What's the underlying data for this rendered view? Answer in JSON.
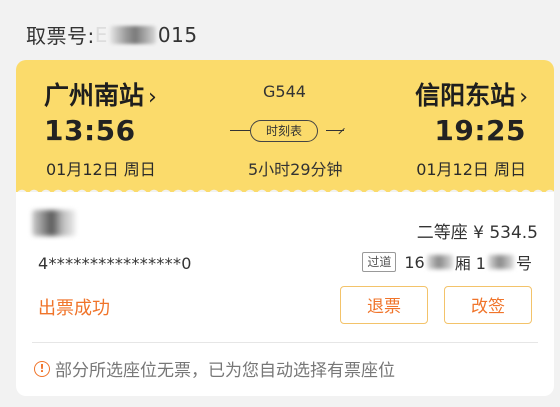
{
  "ticket": {
    "label": "取票号:",
    "number_prefix": "E",
    "number_suffix": "015"
  },
  "train": {
    "number": "G544",
    "schedule_label": "时刻表",
    "duration": "5小时29分钟"
  },
  "departure": {
    "station": "广州南站",
    "time": "13:56",
    "date": "01月12日 周日"
  },
  "arrival": {
    "station": "信阳东站",
    "time": "19:25",
    "date": "01月12日 周日"
  },
  "passenger": {
    "seat_type": "二等座 ¥ 534.5",
    "id_number": "4****************0",
    "seat_badge": "过道",
    "seat_prefix": "16",
    "seat_car": "厢 1",
    "seat_suffix": "号"
  },
  "status": {
    "text": "出票成功"
  },
  "actions": {
    "refund_label": "退票",
    "change_label": "改签"
  },
  "notice": {
    "icon_glyph": "!",
    "text": "部分所选座位无票，已为您自动选择有票座位"
  },
  "icons": {
    "departure_chevron": "chevron-right-icon",
    "arrival_chevron": "chevron-right-icon",
    "notice": "info-icon"
  },
  "colors": {
    "card_top": "#fbdb6b",
    "accent": "#f0742a",
    "button_border": "#f3c36a"
  }
}
